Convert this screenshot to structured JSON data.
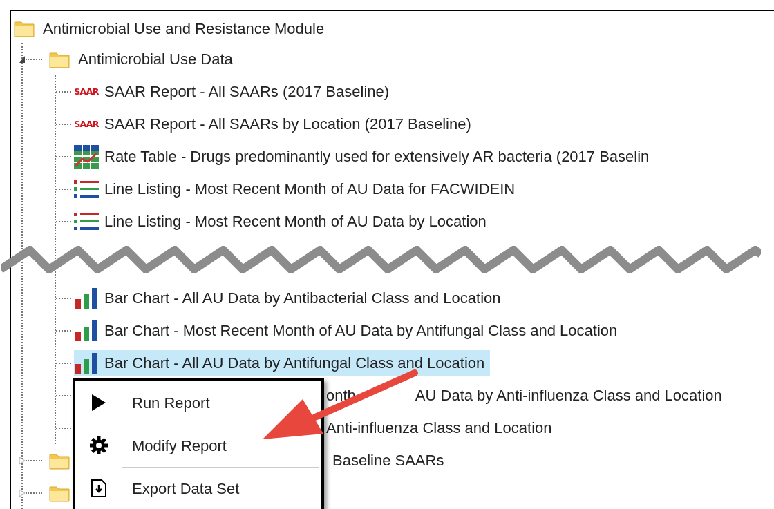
{
  "tree": {
    "label": "Antimicrobial Use and Resistance Module",
    "children": [
      {
        "kind": "folder",
        "label": "Antimicrobial Use Data",
        "expanded": true,
        "children": [
          {
            "kind": "saar",
            "icon_text": "SAAR",
            "label": "SAAR Report - All SAARs (2017 Baseline)",
            "selected": false
          },
          {
            "kind": "saar",
            "icon_text": "SAAR",
            "label": "SAAR Report - All SAARs by Location (2017 Baseline)",
            "selected": false
          },
          {
            "kind": "rate",
            "label": "Rate Table - Drugs predominantly used for extensively AR bacteria (2017 Baselin",
            "selected": false
          },
          {
            "kind": "list",
            "label": "Line Listing - Most Recent Month of AU Data for FACWIDEIN",
            "selected": false
          },
          {
            "kind": "list",
            "label": "Line Listing - Most Recent Month of AU Data by Location",
            "selected": false
          },
          {
            "kind": "torn"
          },
          {
            "kind": "bar",
            "label": "Bar Chart - All AU Data by Antibacterial Class and Location",
            "selected": false
          },
          {
            "kind": "bar",
            "label": "Bar Chart - Most Recent Month of AU Data by Antifungal Class and Location",
            "selected": false
          },
          {
            "kind": "bar",
            "label": "Bar Chart - All AU Data by Antifungal Class and Location",
            "selected": true
          },
          {
            "kind": "partial",
            "labels": [
              "onth",
              "AU Data by Anti-influenza Class and Location"
            ]
          },
          {
            "kind": "partial",
            "labels": [
              "Anti-influenza Class and Location"
            ]
          }
        ]
      },
      {
        "kind": "partial_folder",
        "label": "Baseline SAARs",
        "expanded": false
      },
      {
        "kind": "partial_folder",
        "expanded": false
      }
    ]
  },
  "context_menu": {
    "items": [
      {
        "label": "Run Report",
        "divider": false
      },
      {
        "label": "Modify Report",
        "divider": false
      },
      {
        "label": "Export Data Set",
        "divider": true
      }
    ]
  }
}
